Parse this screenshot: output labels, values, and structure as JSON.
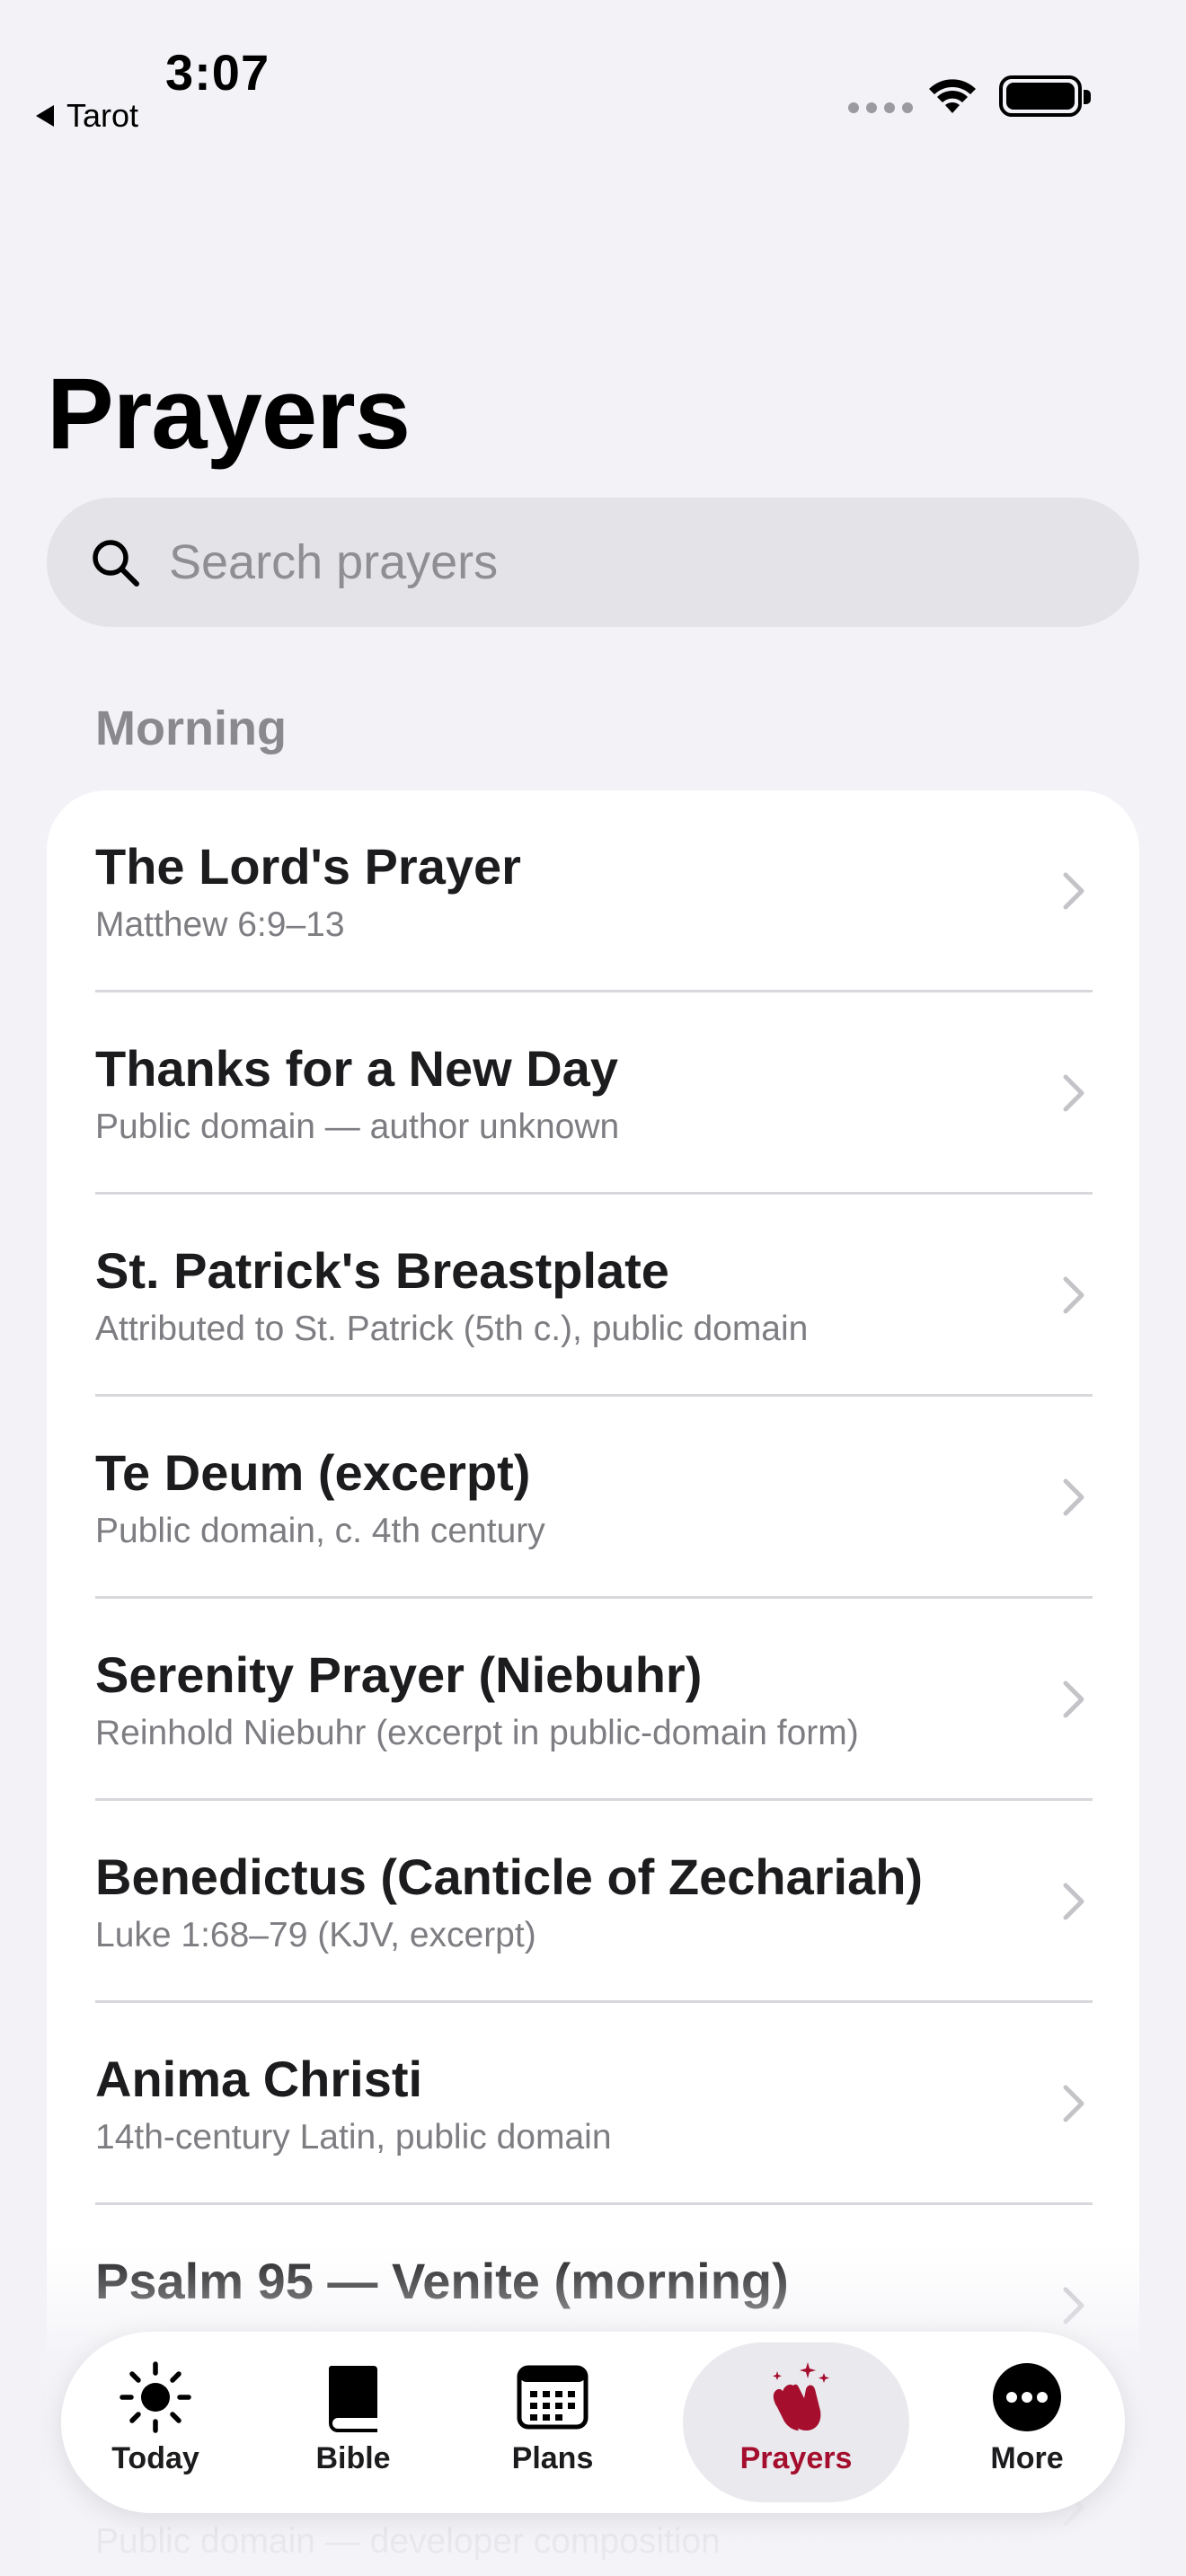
{
  "status_bar": {
    "time": "3:07",
    "back_label": "Tarot"
  },
  "page": {
    "title": "Prayers"
  },
  "search": {
    "placeholder": "Search prayers",
    "value": ""
  },
  "section": {
    "header": "Morning",
    "items": [
      {
        "title": "The Lord's Prayer",
        "subtitle": "Matthew 6:9–13"
      },
      {
        "title": "Thanks for a New Day",
        "subtitle": "Public domain — author unknown"
      },
      {
        "title": "St. Patrick's Breastplate",
        "subtitle": "Attributed to St. Patrick (5th c.), public domain"
      },
      {
        "title": "Te Deum (excerpt)",
        "subtitle": "Public domain, c. 4th century"
      },
      {
        "title": "Serenity Prayer (Niebuhr)",
        "subtitle": "Reinhold Niebuhr (excerpt in public-domain form)"
      },
      {
        "title": "Benedictus (Canticle of Zechariah)",
        "subtitle": "Luke 1:68–79 (KJV, excerpt)"
      },
      {
        "title": "Anima Christi",
        "subtitle": "14th-century Latin, public domain"
      },
      {
        "title": "Psalm 95 — Venite (morning)",
        "subtitle": ""
      },
      {
        "title": "",
        "subtitle": "Public domain — developer composition"
      }
    ]
  },
  "tabbar": {
    "accent_color": "#a50e2d",
    "tabs": [
      {
        "label": "Today",
        "icon": "sun-icon"
      },
      {
        "label": "Bible",
        "icon": "book-icon"
      },
      {
        "label": "Plans",
        "icon": "calendar-icon"
      },
      {
        "label": "Prayers",
        "icon": "praying-hands-icon",
        "active": true
      },
      {
        "label": "More",
        "icon": "more-icon"
      }
    ]
  }
}
